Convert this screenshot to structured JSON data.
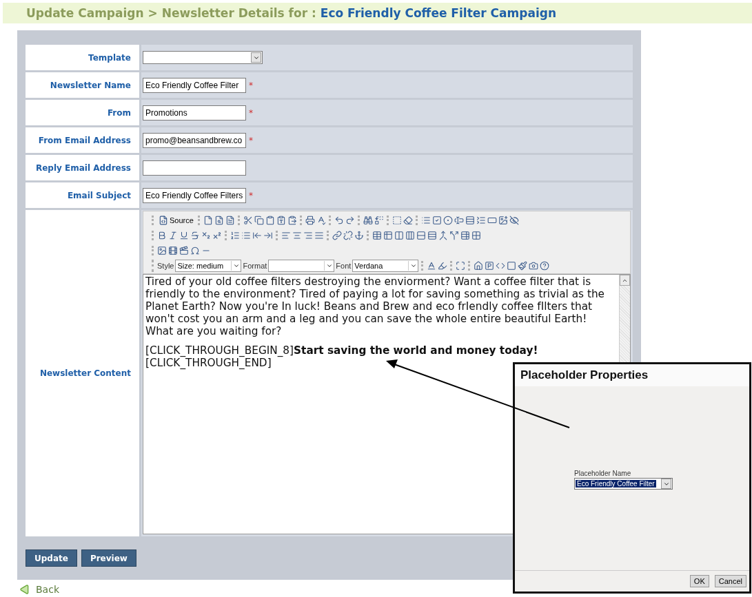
{
  "header": {
    "path": "Update Campaign > Newsletter Details for :",
    "campaign": "Eco Friendly Coffee Filter Campaign"
  },
  "form": {
    "rows": [
      {
        "kind": "select",
        "label": "Template"
      },
      {
        "kind": "text",
        "label": "Newsletter Name",
        "value": "Eco Friendly Coffee Filter",
        "mark": "*"
      },
      {
        "kind": "text",
        "label": "From",
        "value": "Promotions",
        "mark": "*"
      },
      {
        "kind": "text",
        "label": "From Email Address",
        "value": "promo@beansandbrew.co",
        "mark": "*"
      },
      {
        "kind": "text",
        "label": "Reply Email Address"
      },
      {
        "kind": "text",
        "label": "Email Subject",
        "value": "Eco Friendly Coffee Filters",
        "mark": "*"
      },
      {
        "kind": "editor",
        "label": "Newsletter Content"
      }
    ]
  },
  "editor": {
    "source_label": "Source",
    "style_label": "Style",
    "style_value": "Size: medium",
    "format_label": "Format",
    "font_label": "Font",
    "font_value": "Verdana",
    "paragraphs": [
      "Tired of your old coffee filters destroying the enviorment? Want a coffee filter that is friendly to the environment? Tired of paying a lot for saving something as trivial as the Planet Earth? Now you're In luck! Beans and Brew and eco frIendly coffee fIlters that won't cost you an arm and a leg and you can save the whole entire beautiful Earth! What are you waiting for?",
      "[CLICK_THROUGH_BEGIN_8]**Start saving the world and money today!**",
      "[CLICK_THROUGH_END]"
    ]
  },
  "actions": [
    "Update",
    "Preview"
  ],
  "back": "Back",
  "dialog": {
    "title": "Placeholder Properties",
    "field_label": "Placeholder Name",
    "field_value": "Eco Friendly Coffee Filter",
    "buttons": [
      "OK",
      "Cancel"
    ]
  }
}
